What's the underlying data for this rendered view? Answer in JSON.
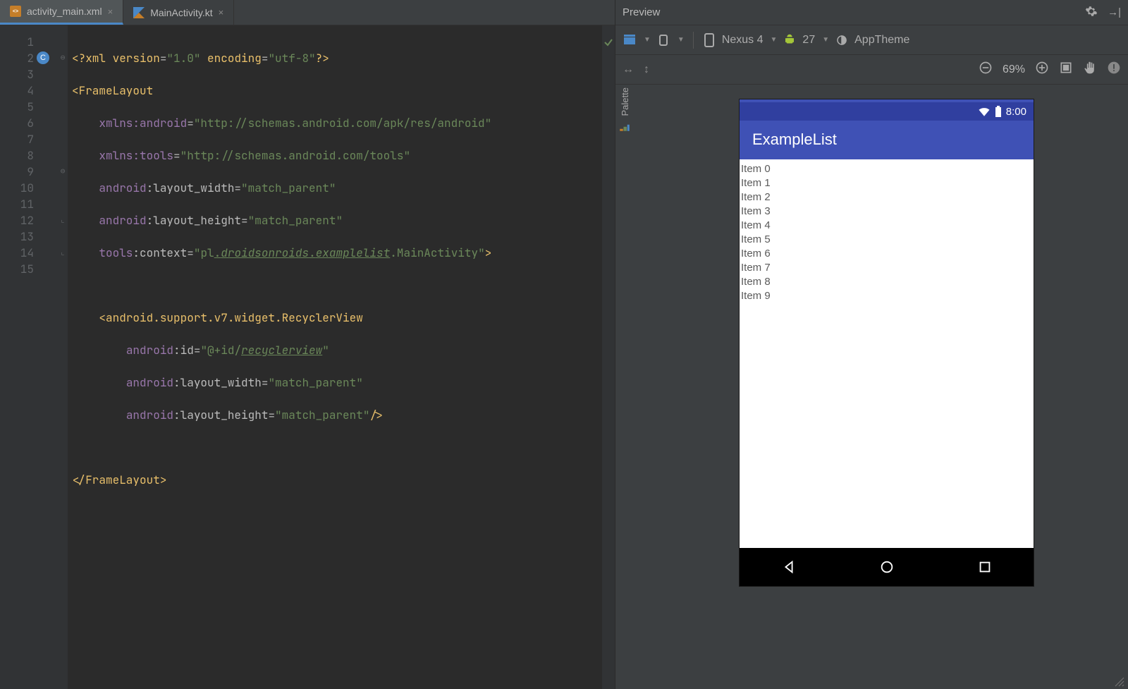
{
  "tabs": [
    {
      "label": "activity_main.xml",
      "active": true
    },
    {
      "label": "MainActivity.kt",
      "active": false
    }
  ],
  "lineNumbers": [
    "1",
    "2",
    "3",
    "4",
    "5",
    "6",
    "7",
    "8",
    "9",
    "10",
    "11",
    "12",
    "13",
    "14",
    "15"
  ],
  "code": {
    "l1": {
      "a": "<?",
      "b": "xml version",
      "c": "=",
      "d": "\"1.0\"",
      "e": " encoding",
      "f": "=",
      "g": "\"utf-8\"",
      "h": "?>"
    },
    "l2": {
      "a": "<",
      "b": "FrameLayout"
    },
    "l3": {
      "a": "xmlns:",
      "b": "android",
      "c": "=",
      "d": "\"http://schemas.android.com/apk/res/android\""
    },
    "l4": {
      "a": "xmlns:",
      "b": "tools",
      "c": "=",
      "d": "\"http://schemas.android.com/tools\""
    },
    "l5": {
      "a": "android",
      "b": ":",
      "c": "layout_width",
      "d": "=",
      "e": "\"match_parent\""
    },
    "l6": {
      "a": "android",
      "b": ":",
      "c": "layout_height",
      "d": "=",
      "e": "\"match_parent\""
    },
    "l7": {
      "a": "tools",
      "b": ":",
      "c": "context",
      "d": "=",
      "e": "\"pl",
      "f": ".",
      "g": "droidsonroids",
      "h": ".",
      "i": "examplelist",
      "j": ".MainActivity\"",
      "k": ">"
    },
    "l9": {
      "a": "<",
      "b": "android.support.v7.widget.RecyclerView"
    },
    "l10": {
      "a": "android",
      "b": ":",
      "c": "id",
      "d": "=",
      "e": "\"@+id/",
      "f": "recyclerview",
      "g": "\""
    },
    "l11": {
      "a": "android",
      "b": ":",
      "c": "layout_width",
      "d": "=",
      "e": "\"match_parent\""
    },
    "l12": {
      "a": "android",
      "b": ":",
      "c": "layout_height",
      "d": "=",
      "e": "\"match_parent\"",
      "f": "/>"
    },
    "l14": {
      "a": "</",
      "b": "FrameLayout",
      "c": ">"
    }
  },
  "preview": {
    "title": "Preview",
    "palette": "Palette",
    "toolbar": {
      "device": "Nexus 4",
      "api": "27",
      "theme": "AppTheme"
    },
    "zoom": "69%",
    "device": {
      "time": "8:00",
      "appTitle": "ExampleList",
      "items": [
        "Item 0",
        "Item 1",
        "Item 2",
        "Item 3",
        "Item 4",
        "Item 5",
        "Item 6",
        "Item 7",
        "Item 8",
        "Item 9"
      ]
    }
  }
}
